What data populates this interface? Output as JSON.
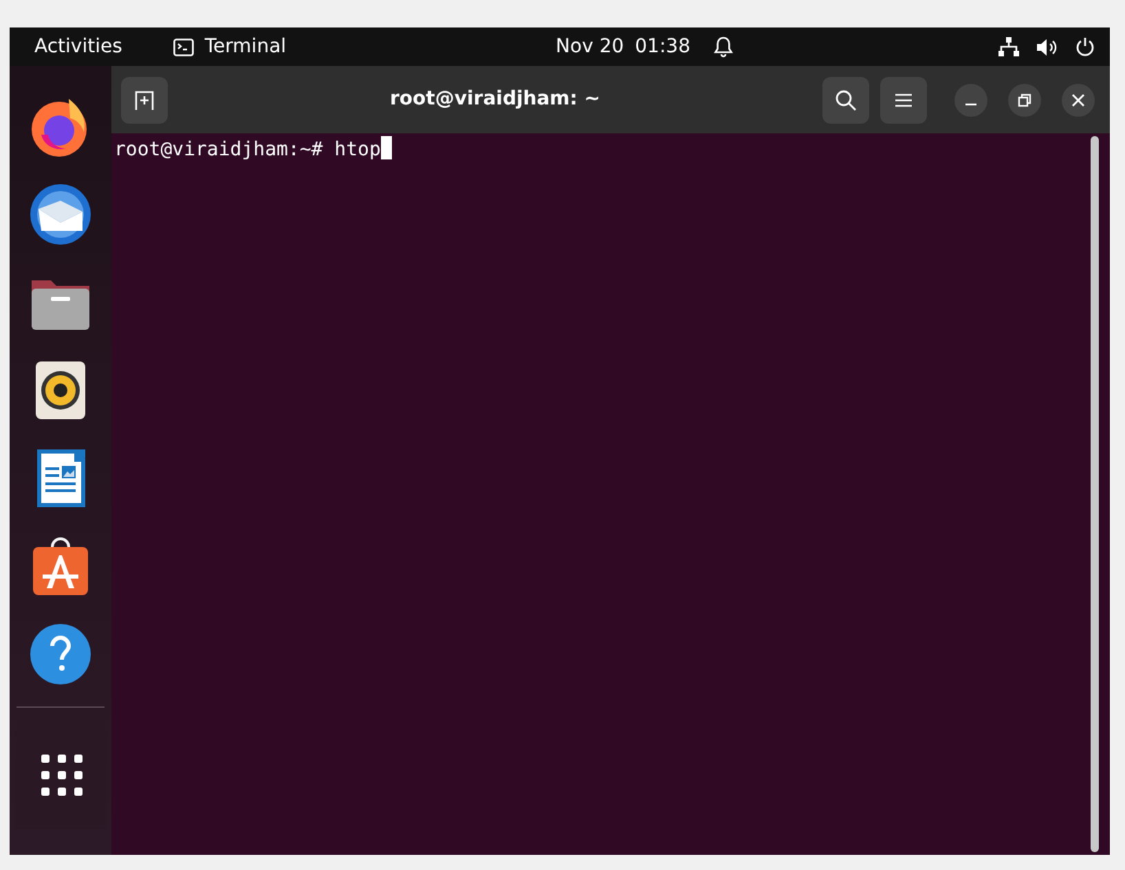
{
  "top_bar": {
    "activities": "Activities",
    "app_name": "Terminal",
    "date": "Nov 20",
    "time": "01:38"
  },
  "terminal": {
    "title": "root@viraidjham: ~",
    "prompt": "root@viraidjham:~# ",
    "command": "htop"
  }
}
